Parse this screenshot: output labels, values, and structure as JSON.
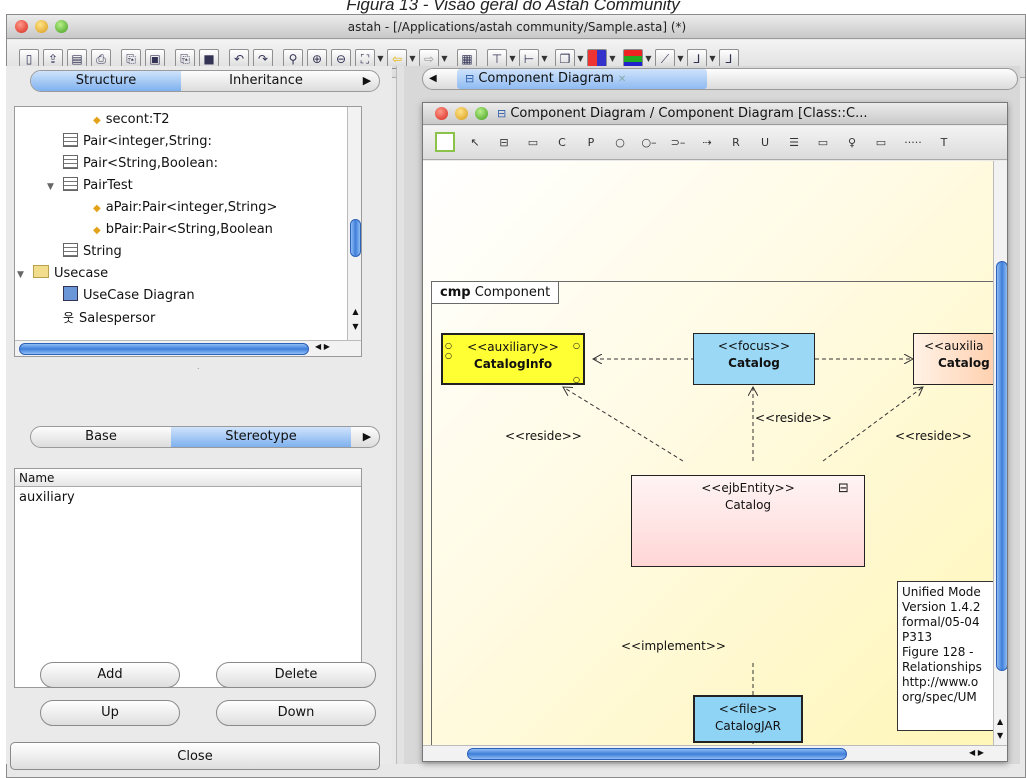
{
  "caption": "Figura 13 - Visão geral do Astah Community",
  "window": {
    "title": "astah - [/Applications/astah community/Sample.asta] (*)"
  },
  "toolbar": {
    "buttons": [
      "new-file",
      "open-file",
      "save",
      "print",
      "copy",
      "paste",
      "copy-image",
      "cut",
      "undo",
      "redo",
      "zoom-fit",
      "zoom-in",
      "zoom-out",
      "fit-window",
      "back",
      "forward",
      "layout",
      "align-top",
      "align-left",
      "layer",
      "fill-color",
      "line-color",
      "line-style",
      "line-end"
    ]
  },
  "left": {
    "tabs": {
      "structure": "Structure",
      "inheritance": "Inheritance"
    },
    "tree": [
      {
        "indent": 2,
        "icon": "diamond",
        "label": "secont:T2",
        "arrow": ""
      },
      {
        "indent": 1,
        "icon": "class",
        "label": "Pair<integer,String:",
        "arrow": ""
      },
      {
        "indent": 1,
        "icon": "class",
        "label": "Pair<String,Boolean:",
        "arrow": ""
      },
      {
        "indent": 1,
        "icon": "class",
        "label": "PairTest",
        "arrow": "▼"
      },
      {
        "indent": 2,
        "icon": "diamond",
        "label": "aPair:Pair<integer,String>",
        "arrow": ""
      },
      {
        "indent": 2,
        "icon": "diamond",
        "label": "bPair:Pair<String,Boolean",
        "arrow": ""
      },
      {
        "indent": 1,
        "icon": "class",
        "label": "String",
        "arrow": ""
      },
      {
        "indent": 0,
        "icon": "folder",
        "label": "Usecase",
        "arrow": "▼"
      },
      {
        "indent": 1,
        "icon": "usecase",
        "label": "UseCase Diagran",
        "arrow": ""
      },
      {
        "indent": 1,
        "icon": "actor",
        "label": "Salespersor",
        "arrow": ""
      }
    ],
    "prop_tabs": {
      "base": "Base",
      "stereotype": "Stereotype"
    },
    "list": {
      "header": "Name",
      "items": [
        "auxiliary"
      ]
    },
    "buttons": {
      "add": "Add",
      "delete": "Delete",
      "up": "Up",
      "down": "Down",
      "close": "Close"
    }
  },
  "diagram_tab": {
    "label": "Component Diagram"
  },
  "inner_window": {
    "title": "Component Diagram / Component Diagram [Class::C...",
    "tool_glyphs": [
      "↖",
      "⊟",
      "▭",
      "C",
      "P",
      "○",
      "○–",
      "⊃–",
      "⇢",
      "R",
      "U",
      "☰",
      "▭",
      "♀",
      "▭",
      "·····",
      "T"
    ]
  },
  "diagram": {
    "frame_kind": "cmp",
    "frame_label": "Component",
    "nodes": {
      "catalog_info": {
        "stereotype": "<<auxiliary>>",
        "name": "CatalogInfo",
        "color": "#ffff33"
      },
      "catalog_focus": {
        "stereotype": "<<focus>>",
        "name": "Catalog",
        "color": "#9ad8f5"
      },
      "catalog_aux": {
        "stereotype": "<<auxilia",
        "name": "Catalog",
        "color": "#ffd7b8"
      },
      "catalog_entity": {
        "stereotype": "<<ejbEntity>>",
        "name": "Catalog",
        "color": "#ffdede"
      },
      "catalog_jar": {
        "stereotype": "<<file>>",
        "name": "CatalogJAR",
        "color": "#8fd3f5"
      }
    },
    "labels": {
      "reside_left": "<<reside>>",
      "reside_mid": "<<reside>>",
      "reside_right": "<<reside>>",
      "implement": "<<implement>>"
    },
    "note_lines": [
      "Unified Mode",
      "Version 1.4.2",
      "formal/05-04",
      "P313",
      "Figure 128 -",
      "Relationships",
      "http://www.o",
      "org/spec/UM"
    ]
  }
}
